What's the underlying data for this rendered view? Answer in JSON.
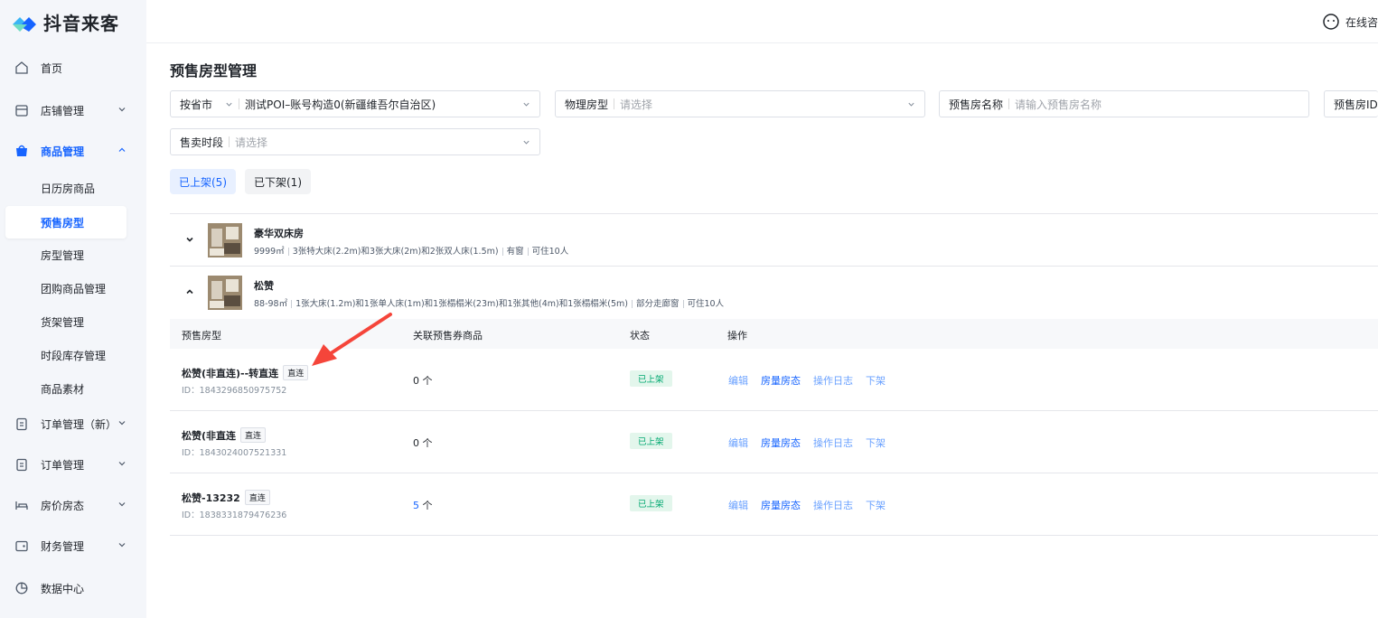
{
  "app": {
    "logo_text": "抖音来客",
    "brand_color": "#1664ff"
  },
  "topbar": {
    "consult_label": "在线咨"
  },
  "sidebar": {
    "items": [
      {
        "label": "首页",
        "icon": "home-icon"
      },
      {
        "label": "店铺管理",
        "icon": "store-icon"
      },
      {
        "label": "商品管理",
        "icon": "bag-icon"
      },
      {
        "label": "订单管理（新）",
        "icon": "clipboard-icon"
      },
      {
        "label": "订单管理",
        "icon": "clipboard-icon"
      },
      {
        "label": "房价房态",
        "icon": "bed-icon"
      },
      {
        "label": "财务管理",
        "icon": "wallet-icon"
      },
      {
        "label": "数据中心",
        "icon": "pie-chart-icon"
      }
    ],
    "sub_items": [
      {
        "label": "日历房商品"
      },
      {
        "label": "预售房型"
      },
      {
        "label": "房型管理"
      },
      {
        "label": "团购商品管理"
      },
      {
        "label": "货架管理"
      },
      {
        "label": "时段库存管理"
      },
      {
        "label": "商品素材"
      }
    ]
  },
  "page": {
    "title": "预售房型管理"
  },
  "filters": {
    "province": {
      "label": "按省市",
      "value": "测试POI–账号构造0(新疆维吾尔自治区)"
    },
    "physical_room": {
      "label": "物理房型",
      "placeholder": "请选择"
    },
    "presale_name": {
      "label": "预售房名称",
      "placeholder": "请输入预售房名称"
    },
    "presale_id": {
      "label": "预售房ID"
    },
    "sale_period": {
      "label": "售卖时段",
      "placeholder": "请选择"
    }
  },
  "tabs": [
    {
      "label": "已上架(5)"
    },
    {
      "label": "已下架(1)"
    }
  ],
  "groups": [
    {
      "name": "豪华双床房",
      "area": "9999㎡",
      "beds": "3张特大床(2.2m)和3张大床(2m)和2张双人床(1.5m)",
      "window": "有窗",
      "capacity": "可住10人"
    },
    {
      "name": "松赞",
      "area": "88-98㎡",
      "beds": "1张大床(1.2m)和1张单人床(1m)和1张榻榻米(23m)和1张其他(4m)和1张榻榻米(5m)",
      "window": "部分走廊窗",
      "capacity": "可住10人"
    }
  ],
  "table": {
    "headers": {
      "room_type": "预售房型",
      "linked": "关联预售券商品",
      "status": "状态",
      "ops": "操作"
    },
    "rows": [
      {
        "name": "松赞(非直连)--转直连",
        "tag": "直连",
        "id": "ID：1843296850975752",
        "count": "0",
        "unit": "个",
        "status": "已上架"
      },
      {
        "name": "松赞(非直连",
        "tag": "直连",
        "id": "ID：1843024007521331",
        "count": "0",
        "unit": "个",
        "status": "已上架"
      },
      {
        "name": "松赞-13232",
        "tag": "直连",
        "id": "ID：1838331879476236",
        "count": "5",
        "unit": "个",
        "status": "已上架"
      }
    ],
    "ops": {
      "edit": "编辑",
      "room_status": "房量房态",
      "log": "操作日志",
      "offline": "下架"
    }
  },
  "colors": {
    "status_green": "#00a870",
    "annotation_red": "#f5453a"
  }
}
